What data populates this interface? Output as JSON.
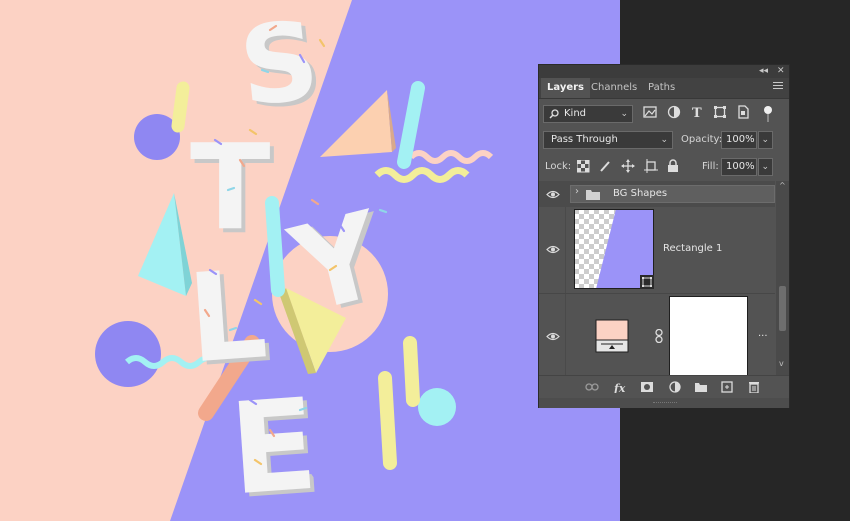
{
  "panel": {
    "collapse_label": "◂◂",
    "close_label": "✕",
    "tabs": [
      {
        "label": "Layers"
      },
      {
        "label": "Channels"
      },
      {
        "label": "Paths"
      }
    ],
    "filter": {
      "label": "Kind"
    },
    "blend_mode": {
      "label": "Pass Through"
    },
    "opacity": {
      "label": "Opacity:",
      "value": "100%"
    },
    "lock": {
      "label": "Lock:"
    },
    "fill": {
      "label": "Fill:",
      "value": "100%"
    },
    "layers": [
      {
        "name": "BG Shapes",
        "type": "group"
      },
      {
        "name": "Rectangle 1",
        "type": "shape"
      },
      {
        "name": "",
        "type": "solid-fill",
        "mask_label": "..."
      }
    ]
  },
  "colors": {
    "peach": "#fcd2c4",
    "violet": "#9b93f8",
    "cyan": "#a3f1f3",
    "yellow": "#f3ee9a",
    "panel_bg": "#535353",
    "workspace": "#262626"
  },
  "artwork": {
    "letters": [
      "S",
      "T",
      "Y",
      "L",
      "E"
    ]
  }
}
